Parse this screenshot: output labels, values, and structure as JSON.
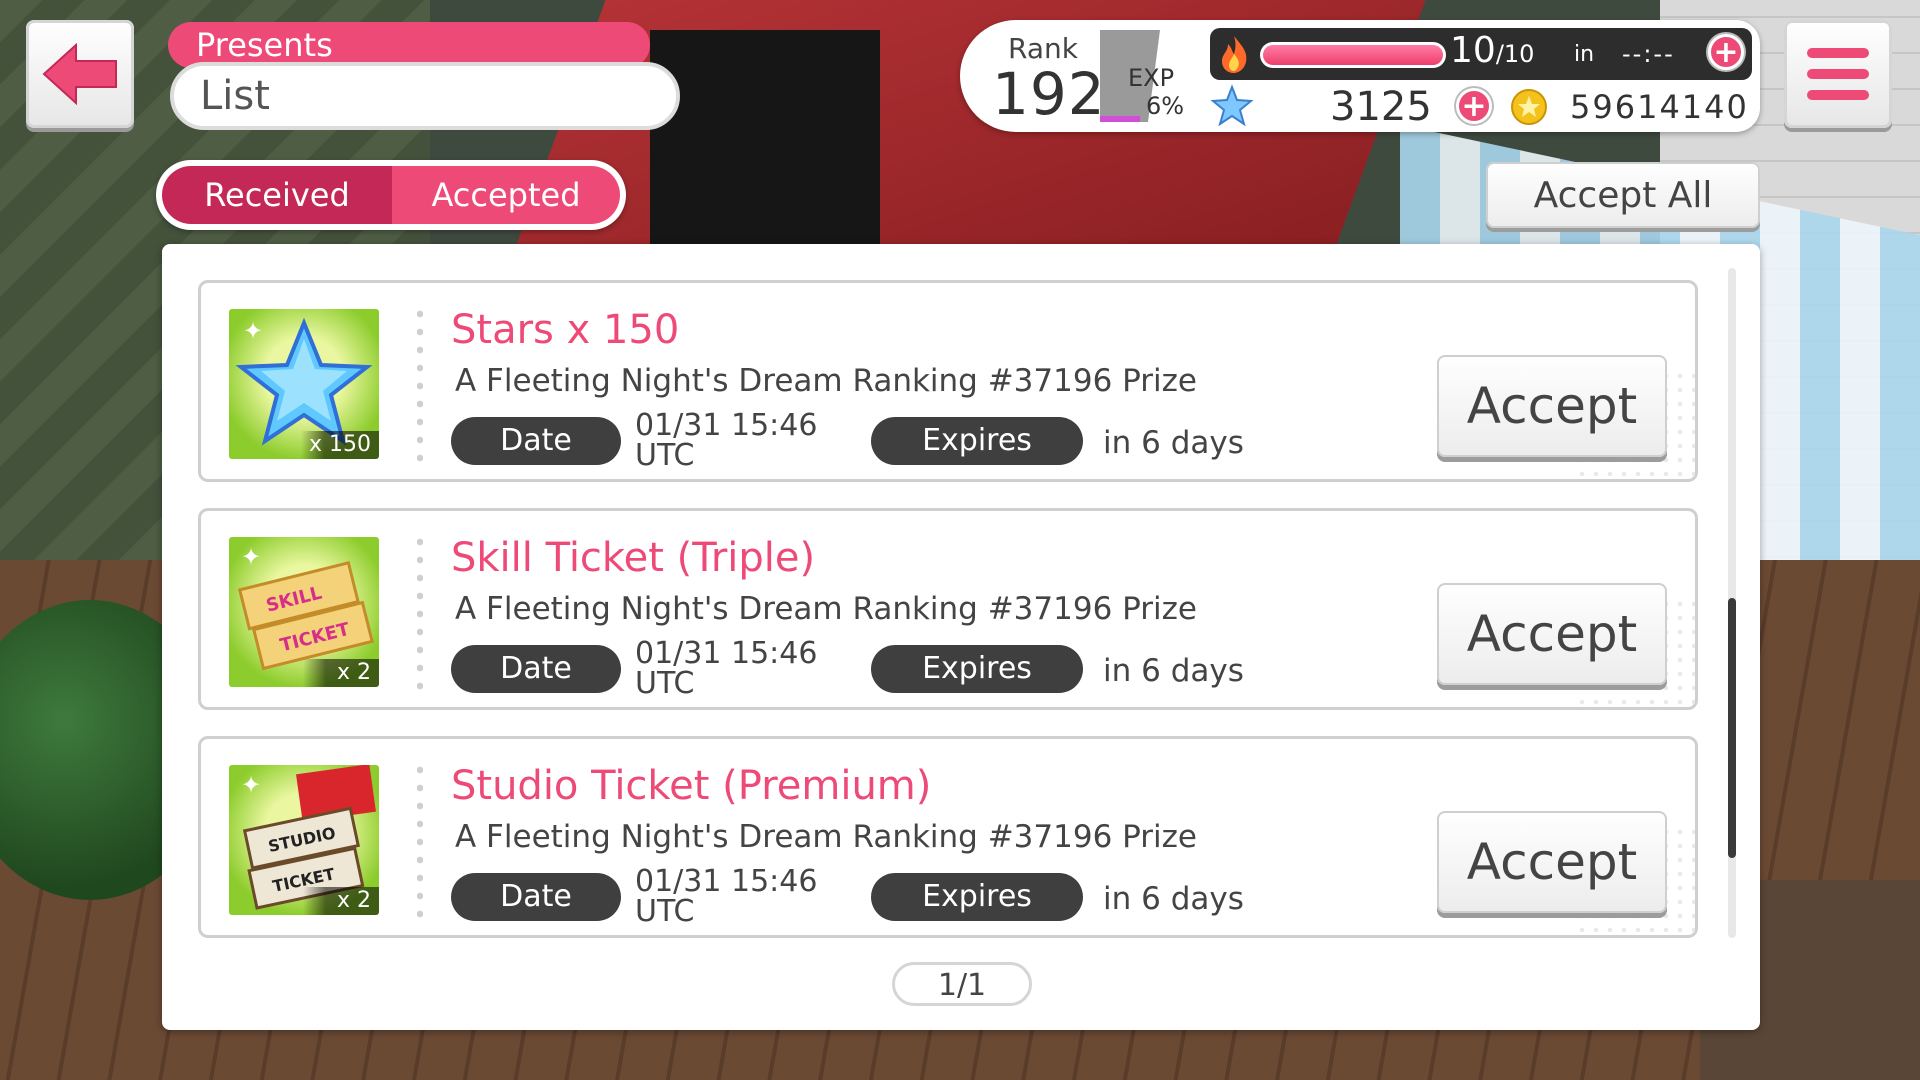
{
  "header": {
    "section": "Presents",
    "title": "List"
  },
  "tabs": [
    {
      "label": "Received",
      "active": true
    },
    {
      "label": "Accepted",
      "active": false
    }
  ],
  "status": {
    "rank_label": "Rank",
    "rank_value": "192",
    "exp_label": "EXP",
    "exp_percent": "6%",
    "stamina_current": "10",
    "stamina_max": "/10",
    "stamina_fraction": 1.0,
    "recover_in_label": "in",
    "recover_timer": "--:--",
    "stars": "3125",
    "coins": "59614140"
  },
  "actions": {
    "accept_all": "Accept All"
  },
  "presents": [
    {
      "icon": "star-gem-icon",
      "quantity": "x 150",
      "name": "Stars x 150",
      "source": "A Fleeting Night's Dream Ranking #37196 Prize",
      "date_label": "Date",
      "date_value": "01/31 15:46",
      "date_tz": "UTC",
      "expires_label": "Expires",
      "expires_value": "in 6 days",
      "accept_label": "Accept"
    },
    {
      "icon": "skill-ticket-icon",
      "quantity": "x 2",
      "name": "Skill Ticket (Triple)",
      "source": "A Fleeting Night's Dream Ranking #37196 Prize",
      "date_label": "Date",
      "date_value": "01/31 15:46",
      "date_tz": "UTC",
      "expires_label": "Expires",
      "expires_value": "in 6 days",
      "accept_label": "Accept"
    },
    {
      "icon": "studio-ticket-icon",
      "quantity": "x 2",
      "name": "Studio Ticket (Premium)",
      "source": "A Fleeting Night's Dream Ranking #37196 Prize",
      "date_label": "Date",
      "date_value": "01/31 15:46",
      "date_tz": "UTC",
      "expires_label": "Expires",
      "expires_value": "in 6 days",
      "accept_label": "Accept"
    }
  ],
  "pagination": "1/1",
  "colors": {
    "accent_pink": "#ee4a78",
    "active_tab": "#c42857",
    "pill_dark": "#3f3f3f"
  }
}
